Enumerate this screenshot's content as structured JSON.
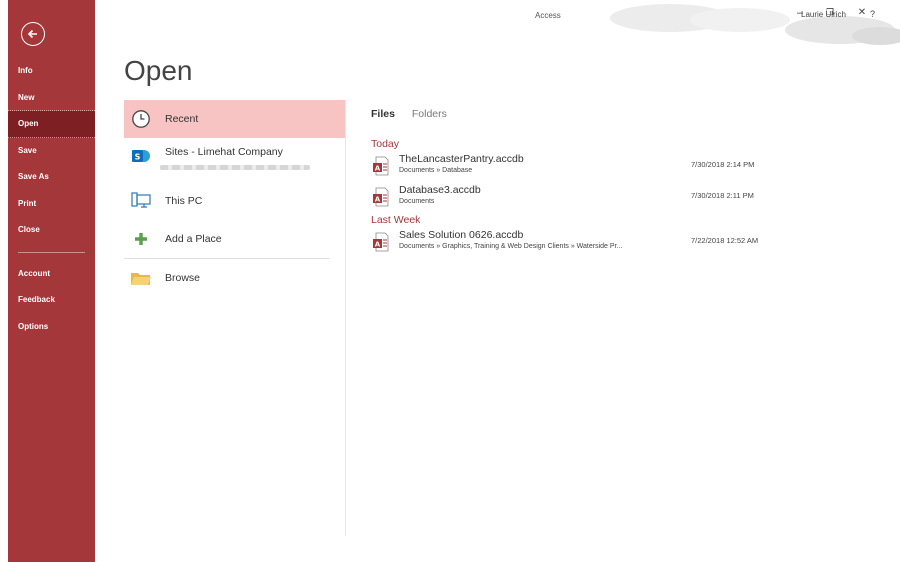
{
  "titlebar": {
    "app_title": "Access",
    "user_name": "Laurie Ulrich",
    "help": "?",
    "minimize": "–",
    "restore": "❐",
    "close": "✕"
  },
  "nav": {
    "items": [
      {
        "label": "Info"
      },
      {
        "label": "New"
      },
      {
        "label": "Open"
      },
      {
        "label": "Save"
      },
      {
        "label": "Save As"
      },
      {
        "label": "Print"
      },
      {
        "label": "Close"
      },
      {
        "label": "Account"
      },
      {
        "label": "Feedback"
      },
      {
        "label": "Options"
      }
    ],
    "selected": "Open"
  },
  "page": {
    "title": "Open"
  },
  "locations": [
    {
      "label": "Recent",
      "icon": "clock-icon"
    },
    {
      "label": "Sites - Limehat Company",
      "icon": "sharepoint-icon"
    },
    {
      "label": "This PC",
      "icon": "computer-icon"
    },
    {
      "label": "Add a Place",
      "icon": "plus-icon"
    },
    {
      "label": "Browse",
      "icon": "folder-icon"
    }
  ],
  "tabs": {
    "files": "Files",
    "folders": "Folders"
  },
  "groups": {
    "today": "Today",
    "last_week": "Last Week"
  },
  "files": [
    {
      "name": "TheLancasterPantry.accdb",
      "path": "Documents » Database",
      "date": "7/30/2018 2:14 PM"
    },
    {
      "name": "Database3.accdb",
      "path": "Documents",
      "date": "7/30/2018 2:11 PM"
    },
    {
      "name": "Sales Solution 0626.accdb",
      "path": "Documents » Graphics, Training  & Web Design Clients » Waterside Pr...",
      "date": "7/22/2018 12:52 AM"
    }
  ],
  "colors": {
    "accent": "#a4373a",
    "nav_selected": "#7d1f23",
    "recent_highlight": "#f7c3c3"
  }
}
